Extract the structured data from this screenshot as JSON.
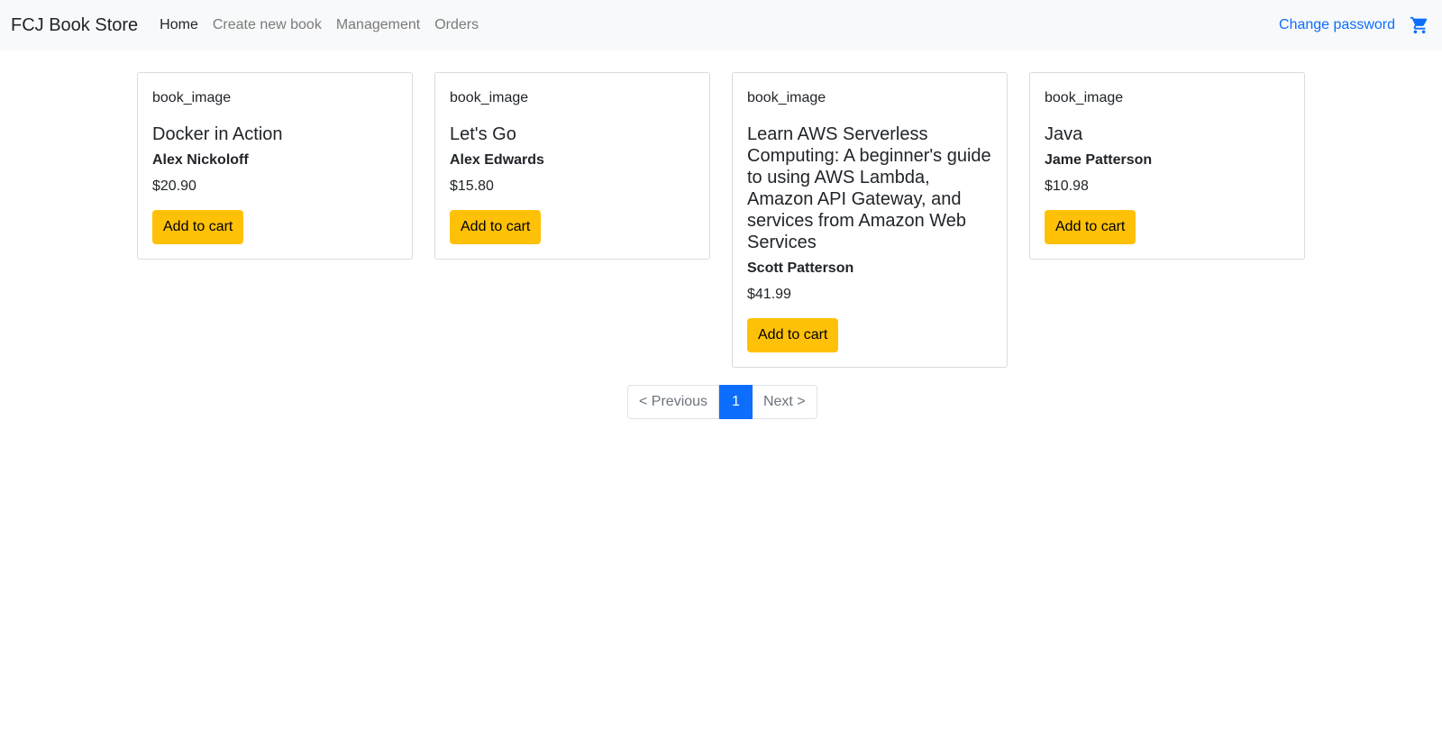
{
  "navbar": {
    "brand": "FCJ Book Store",
    "links": [
      {
        "label": "Home",
        "active": true
      },
      {
        "label": "Create new book",
        "active": false
      },
      {
        "label": "Management",
        "active": false
      },
      {
        "label": "Orders",
        "active": false
      }
    ],
    "change_password": "Change password",
    "cart_icon": "shopping-cart-icon",
    "accent_color": "#0d6efd"
  },
  "books": [
    {
      "image_alt": "book_image",
      "title": "Docker in Action",
      "author": "Alex Nickoloff",
      "price": "$20.90",
      "button": "Add to cart"
    },
    {
      "image_alt": "book_image",
      "title": "Let's Go",
      "author": "Alex Edwards",
      "price": "$15.80",
      "button": "Add to cart"
    },
    {
      "image_alt": "book_image",
      "title": "Learn AWS Serverless Computing: A beginner's guide to using AWS Lambda, Amazon API Gateway, and services from Amazon Web Services",
      "author": "Scott Patterson",
      "price": "$41.99",
      "button": "Add to cart"
    },
    {
      "image_alt": "book_image",
      "title": "Java",
      "author": "Jame Patterson",
      "price": "$10.98",
      "button": "Add to cart"
    }
  ],
  "pagination": {
    "previous": "< Previous",
    "current": "1",
    "next": "Next >"
  },
  "colors": {
    "button_bg": "#ffc107",
    "page_active": "#0d6efd"
  }
}
